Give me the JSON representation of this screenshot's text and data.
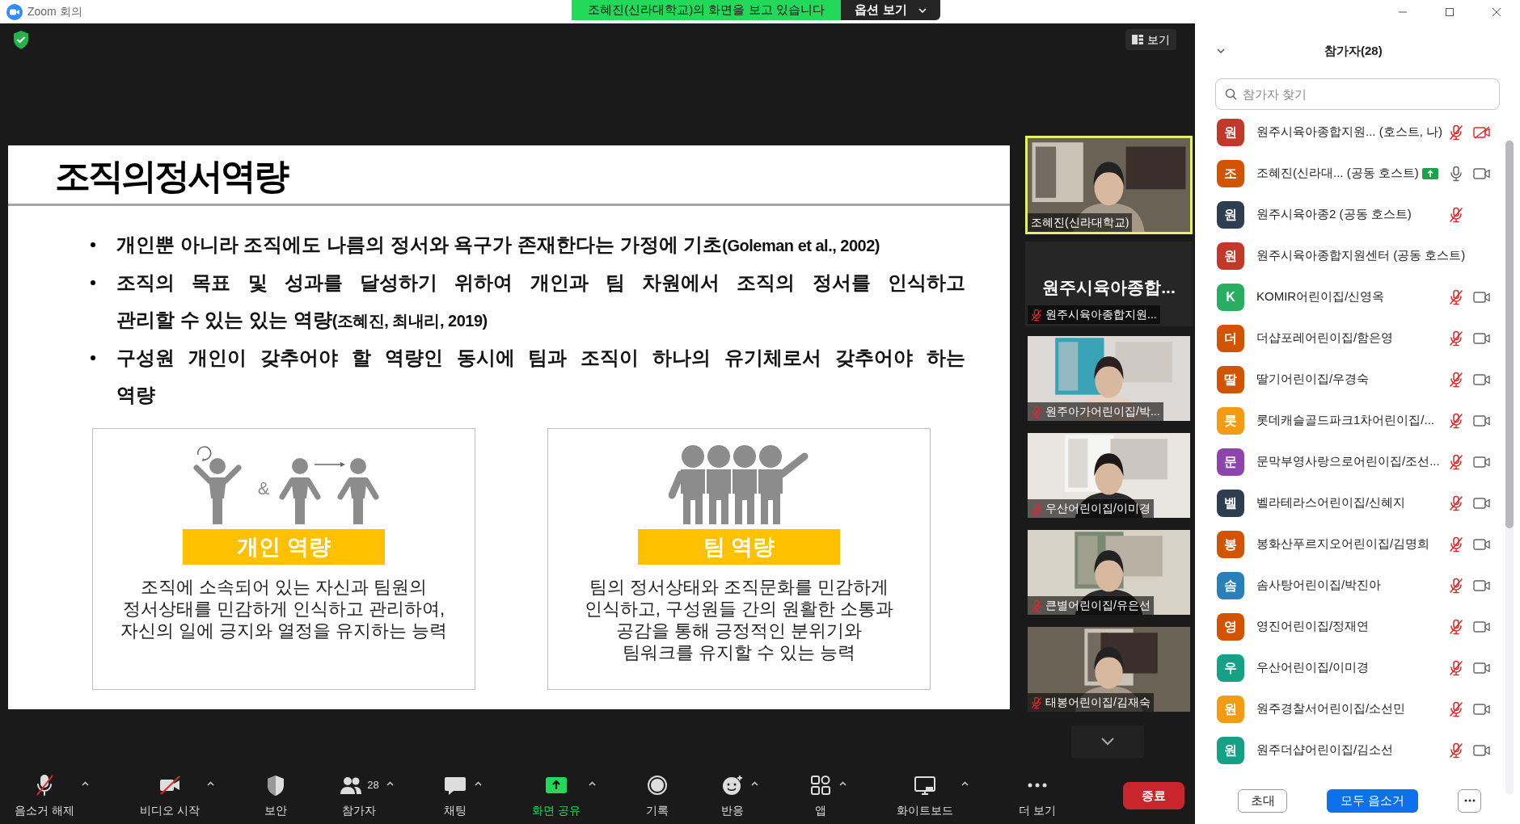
{
  "window": {
    "title": "Zoom 회의"
  },
  "share_banner": {
    "text": "조혜진(신라대학교)의 화면을 보고 있습니다",
    "button": "옵션 보기"
  },
  "view_button": "보기",
  "slide": {
    "title": "조직의정서역량",
    "bullets": [
      {
        "lines": [
          "개인뿐 아니라 조직에도 나름의 정서와 욕구가 존재한다는 가정에 기초"
        ],
        "cite": "(Goleman et al., 2002)"
      },
      {
        "lines": [
          "조직의 목표 및 성과를 달성하기 위하여 개인과 팀 차원에서 조직의 정서를 인식하고",
          "관리할 수 있는 있는 역량"
        ],
        "cite": "(조혜진, 최내리, 2019)"
      },
      {
        "lines": [
          "구성원 개인이 갖추어야 할 역량인 동시에 팀과 조직이 하나의 유기체로서 갖추어야 하는",
          "역량"
        ]
      }
    ],
    "cards": [
      {
        "kind": "individual",
        "connector": "&",
        "label": "개인 역량",
        "lines": [
          "조직에 소속되어 있는 자신과 팀원의",
          "정서상태를 민감하게 인식하고 관리하여,",
          "자신의 일에 긍지와 열정을 유지하는 능력"
        ]
      },
      {
        "kind": "team",
        "label": "팀 역량",
        "lines": [
          "팀의 정서상태와 조직문화를 민감하게",
          "인식하고, 구성원들 간의 원활한 소통과",
          "공감을 통해 긍정적인 분위기와",
          "팀워크를 유지할 수 있는 능력"
        ]
      }
    ]
  },
  "videos": [
    {
      "kind": "picture",
      "name": "조혜진(신라대학교)",
      "speaking": true,
      "muted": false
    },
    {
      "kind": "no_video",
      "display_name": "원주시육아종합...",
      "name": "원주시육아종합지원...",
      "speaking": false,
      "muted": true
    },
    {
      "kind": "picture",
      "name": "원주아가어린이집/박...",
      "speaking": false,
      "muted": true
    },
    {
      "kind": "picture",
      "name": "우산어린이집/이미경",
      "speaking": false,
      "muted": true
    },
    {
      "kind": "picture",
      "name": "큰별어린이집/유은선",
      "speaking": false,
      "muted": true
    },
    {
      "kind": "picture",
      "name": "태봉어린이집/김재숙",
      "speaking": false,
      "muted": true
    }
  ],
  "toolbar": [
    {
      "label": "음소거 해제",
      "caret": true,
      "highlighted": false
    },
    {
      "label": "비디오 시작",
      "caret": true,
      "highlighted": false
    },
    {
      "label": "보안",
      "caret": false,
      "highlighted": false
    },
    {
      "label": "참가자",
      "count": "28",
      "caret": true,
      "highlighted": false
    },
    {
      "label": "채팅",
      "caret": true,
      "highlighted": false
    },
    {
      "label": "화면 공유",
      "caret": true,
      "highlighted": true
    },
    {
      "label": "기록",
      "caret": false,
      "highlighted": false
    },
    {
      "label": "반응",
      "caret": true,
      "highlighted": false
    },
    {
      "label": "앱",
      "caret": true,
      "highlighted": false
    },
    {
      "label": "화이트보드",
      "caret": true,
      "highlighted": false
    },
    {
      "label": "더 보기",
      "caret": false,
      "highlighted": false
    }
  ],
  "end_button": "종료",
  "participants_panel": {
    "title": "참가자(28)",
    "search_placeholder": "참가자 찾기",
    "participants": [
      {
        "initial": "원",
        "color": "#c0392b",
        "name": "원주시육아종합지원... (호스트, 나)",
        "sharing": false,
        "kind": "media",
        "muted": true,
        "video_off": true
      },
      {
        "initial": "조",
        "color": "#d35400",
        "name": "조혜진(신라대... (공동 호스트)",
        "sharing": true,
        "kind": "media",
        "muted": false,
        "video_off": false
      },
      {
        "initial": "원",
        "color": "#2c3e50",
        "name": "원주시육아종2 (공동 호스트)",
        "sharing": false,
        "kind": "audio",
        "muted": true
      },
      {
        "initial": "원",
        "color": "#c0392b",
        "name": "원주시육아종합지원센터 (공동 호스트)",
        "sharing": false,
        "kind": "none"
      },
      {
        "initial": "K",
        "color": "#27ae60",
        "name": "KOMIR어린이집/신영옥",
        "sharing": false,
        "kind": "media",
        "muted": true,
        "video_off": false
      },
      {
        "initial": "더",
        "color": "#d35400",
        "name": "더샵포레어린이집/함은영",
        "sharing": false,
        "kind": "media",
        "muted": true,
        "video_off": false
      },
      {
        "initial": "딸",
        "color": "#d35400",
        "name": "딸기어린이집/우경숙",
        "sharing": false,
        "kind": "media",
        "muted": true,
        "video_off": false
      },
      {
        "initial": "롯",
        "color": "#f39c12",
        "name": "롯데캐슬골드파크1차어린이집/...",
        "sharing": false,
        "kind": "media",
        "muted": true,
        "video_off": false
      },
      {
        "initial": "문",
        "color": "#8e44ad",
        "name": "문막부영사랑으로어린이집/조선...",
        "sharing": false,
        "kind": "media",
        "muted": true,
        "video_off": false
      },
      {
        "initial": "벨",
        "color": "#2c3e50",
        "name": "벨라테라스어린이집/신혜지",
        "sharing": false,
        "kind": "media",
        "muted": true,
        "video_off": false
      },
      {
        "initial": "봉",
        "color": "#d35400",
        "name": "봉화산푸르지오어린이집/김명희",
        "sharing": false,
        "kind": "media",
        "muted": true,
        "video_off": false
      },
      {
        "initial": "솜",
        "color": "#2980b9",
        "name": "솜사탕어린이집/박진아",
        "sharing": false,
        "kind": "media",
        "muted": true,
        "video_off": false
      },
      {
        "initial": "영",
        "color": "#d35400",
        "name": "영진어린이집/정재연",
        "sharing": false,
        "kind": "media",
        "muted": true,
        "video_off": false
      },
      {
        "initial": "우",
        "color": "#16a085",
        "name": "우산어린이집/이미경",
        "sharing": false,
        "kind": "media",
        "muted": true,
        "video_off": false
      },
      {
        "initial": "원",
        "color": "#f39c12",
        "name": "원주경찰서어린이집/소선민",
        "sharing": false,
        "kind": "media",
        "muted": true,
        "video_off": false
      },
      {
        "initial": "원",
        "color": "#16a085",
        "name": "원주더샵어린이집/김소선",
        "sharing": false,
        "kind": "media",
        "muted": true,
        "video_off": false
      }
    ],
    "buttons": {
      "invite": "초대",
      "mute_all": "모두 음소거"
    }
  }
}
